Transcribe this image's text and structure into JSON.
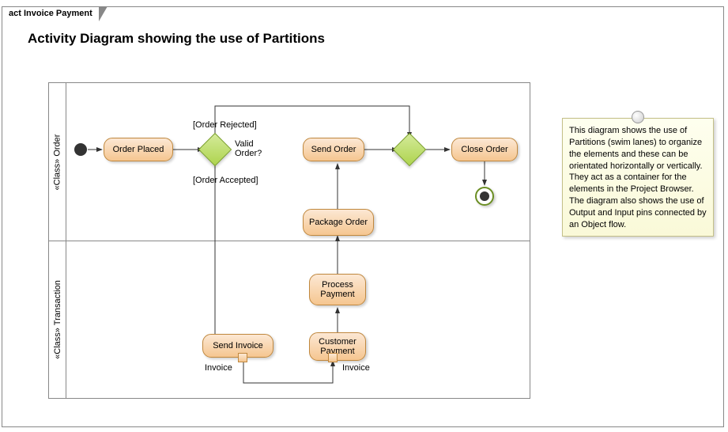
{
  "frame_label": "act Invoice Payment",
  "title": "Activity Diagram showing the use of Partitions",
  "partitions": {
    "order": "«Class» Order",
    "transaction": "«Class» Transaction"
  },
  "activities": {
    "order_placed": "Order Placed",
    "send_order": "Send Order",
    "close_order": "Close Order",
    "package_order": "Package Order",
    "process_payment": "Process Payment",
    "send_invoice": "Send Invoice",
    "customer_payment": "Customer Payment"
  },
  "decision": {
    "valid_order": "Valid Order?"
  },
  "guards": {
    "order_rejected": "[Order Rejected]",
    "order_accepted": "[Order Accepted]"
  },
  "pins": {
    "invoice_out": "Invoice",
    "invoice_in": "Invoice"
  },
  "note": "This diagram shows the use of Partitions (swim lanes) to organize the elements and these can be orientated horizontally or vertically. They act as a container for the elements in the Project Browser. The diagram also shows the use of Output and Input pins connected by an Object flow."
}
